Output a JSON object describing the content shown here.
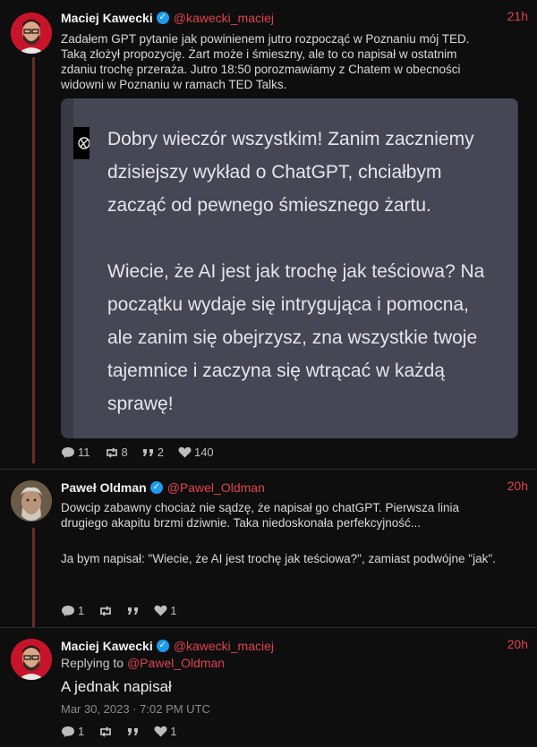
{
  "tweets": [
    {
      "author": "Maciej Kawecki",
      "handle": "@kawecki_maciej",
      "time": "21h",
      "text_lines": [
        "Zadałem GPT pytanie jak powinienem jutro rozpocząć w Poznaniu mój TED.",
        "Taką złożył propozycję. Żart może i śmieszny, ale to co napisał w ostatnim",
        "zdaniu trochę przeraża. Jutro 18:50 porozmawiamy z Chatem w obecności",
        "widowni w Poznaniu w ramach TED Talks."
      ],
      "media_lines": [
        "Dobry wieczór wszystkim! Zanim zaczniemy",
        "dzisiejszy wykład o ChatGPT, chciałbym",
        "zacząć od pewnego śmiesznego żartu.",
        "",
        "Wiecie, że AI jest jak trochę jak teściowa? Na",
        "początku wydaje się intrygująca i pomocna,",
        "ale zanim się obejrzysz, zna wszystkie twoje",
        "tajemnice i zaczyna się wtrącać w każdą",
        "sprawę!"
      ],
      "stats": {
        "replies": "11",
        "retweets": "8",
        "quotes": "2",
        "likes": "140"
      }
    },
    {
      "author": "Paweł Oldman",
      "handle": "@Pawel_Oldman",
      "time": "20h",
      "text_lines": [
        "Dowcip zabawny chociaż nie sądzę, że napisał go chatGPT. Pierwsza linia",
        "drugiego akapitu brzmi dziwnie. Taka niedoskonała perfekcyjność...",
        "",
        "Ja bym napisał: \"Wiecie, że AI jest trochę jak teściowa?\", zamiast podwójne \"jak\"."
      ],
      "stats": {
        "replies": "1",
        "likes": "1"
      }
    },
    {
      "author": "Maciej Kawecki",
      "handle": "@kawecki_maciej",
      "time": "20h",
      "replying_label": "Replying to",
      "replying_handle": "@Pawel_Oldman",
      "text": "A jednak napisał",
      "date": "Mar 30, 2023 · 7:02 PM UTC",
      "stats": {
        "replies": "1",
        "likes": "1"
      }
    }
  ],
  "colors": {
    "accent": "#e0414f",
    "verified": "#1d9bf0",
    "thread": "#6e2a2a"
  }
}
